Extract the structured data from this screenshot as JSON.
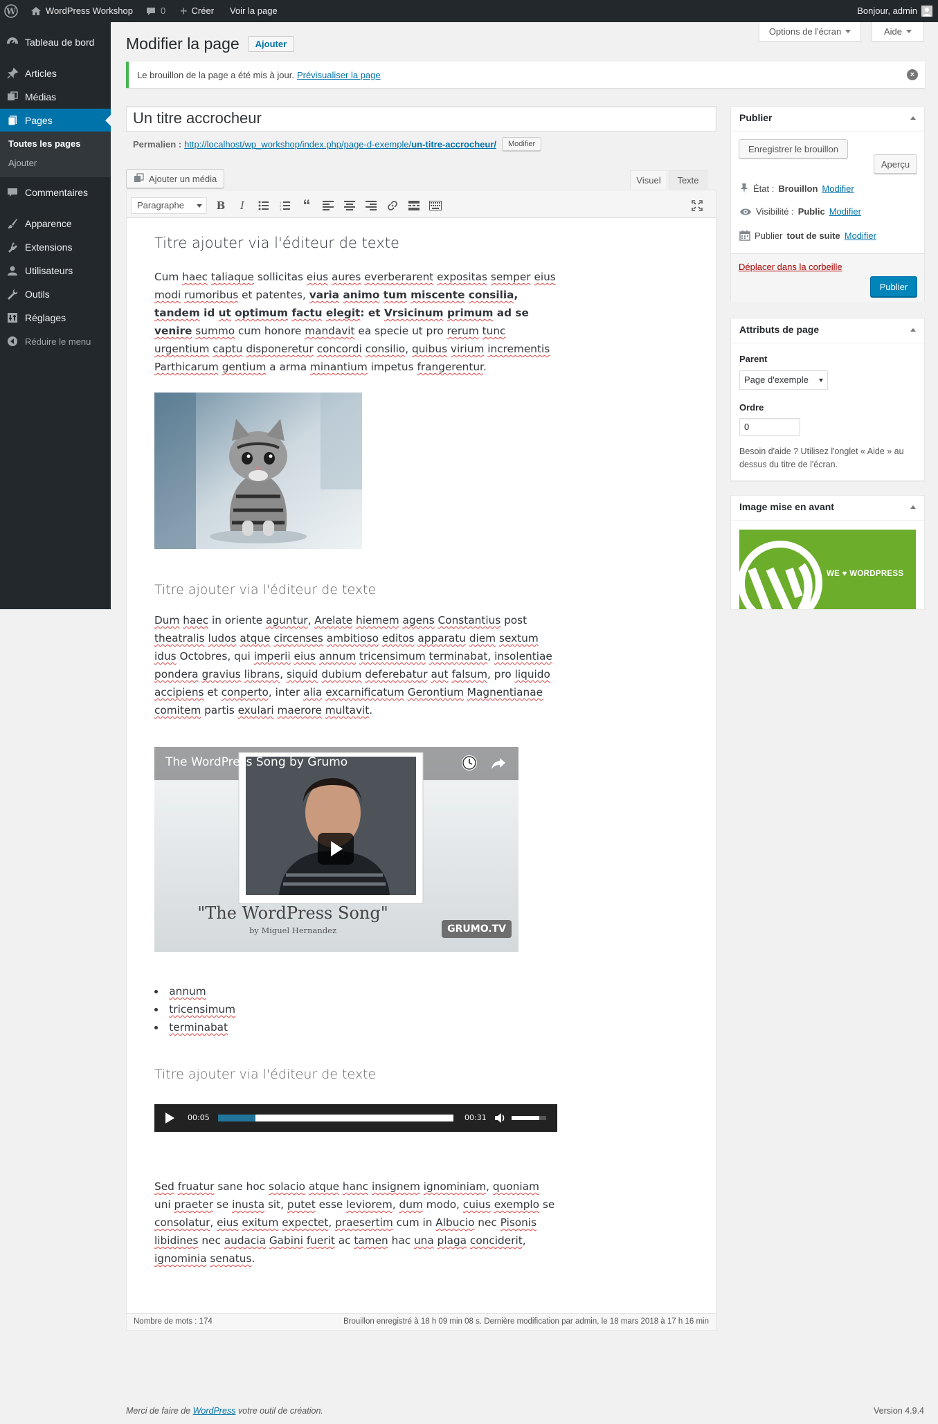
{
  "admin_bar": {
    "site_name": "WordPress Workshop",
    "comments_count": "0",
    "new_label": "Créer",
    "view_page_label": "Voir la page",
    "greeting": "Bonjour, admin"
  },
  "sidebar": {
    "items": [
      {
        "label": "Tableau de bord",
        "icon": "dashboard-icon"
      },
      {
        "label": "Articles",
        "icon": "pin-icon"
      },
      {
        "label": "Médias",
        "icon": "media-icon"
      },
      {
        "label": "Pages",
        "icon": "pages-icon"
      },
      {
        "label": "Commentaires",
        "icon": "comment-icon"
      },
      {
        "label": "Apparence",
        "icon": "brush-icon"
      },
      {
        "label": "Extensions",
        "icon": "plugin-icon"
      },
      {
        "label": "Utilisateurs",
        "icon": "user-icon"
      },
      {
        "label": "Outils",
        "icon": "wrench-icon"
      },
      {
        "label": "Réglages",
        "icon": "settings-icon"
      }
    ],
    "submenu": [
      "Toutes les pages",
      "Ajouter"
    ],
    "collapse_label": "Réduire le menu"
  },
  "screen_options": {
    "options_label": "Options de l'écran",
    "help_label": "Aide"
  },
  "header": {
    "title": "Modifier la page",
    "add_new_label": "Ajouter"
  },
  "notice": {
    "text": "Le brouillon de la page a été mis à jour.",
    "link": "Prévisualiser la page"
  },
  "post": {
    "title": "Un titre accrocheur",
    "permalink_label": "Permalien :",
    "permalink_base": "http://localhost/wp_workshop/index.php/page-d-exemple/",
    "permalink_slug": "un-titre-accrocheur/",
    "permalink_edit": "Modifier"
  },
  "editor": {
    "add_media_label": "Ajouter un média",
    "tab_visual": "Visuel",
    "tab_text": "Texte",
    "format_value": "Paragraphe",
    "heading_1": "Titre ajouter via l'éditeur de texte",
    "heading_2": "Titre ajouter via l'éditeur de texte",
    "heading_3": "Titre ajouter via l'éditeur de texte",
    "video_title": "The WordPress Song by Grumo",
    "video_caption": "\"The WordPress Song\"",
    "video_byline": "by Miguel Hernandez",
    "video_brand": "GRUMO.TV",
    "list_items": [
      "annum",
      "tricensimum",
      "terminabat"
    ],
    "audio_current": "00:05",
    "audio_duration": "00:31",
    "audio_progress": 0.16,
    "word_count": "Nombre de mots : 174",
    "autosave_status": "Brouillon enregistré à 18 h 09 min 08 s. Dernière modification par admin, le 18 mars 2018 à 17 h 16 min"
  },
  "publish_box": {
    "title": "Publier",
    "save_draft": "Enregistrer le brouillon",
    "preview": "Aperçu",
    "status_label": "État :",
    "status_value": "Brouillon",
    "visibility_label": "Visibilité :",
    "visibility_value": "Public",
    "schedule_label": "Publier",
    "schedule_value": "tout de suite",
    "edit_link": "Modifier",
    "trash": "Déplacer dans la corbeille",
    "publish": "Publier"
  },
  "page_attributes": {
    "title": "Attributs de page",
    "parent_label": "Parent",
    "parent_value": "Page d'exemple",
    "order_label": "Ordre",
    "order_value": "0",
    "help": "Besoin d'aide ? Utilisez l'onglet « Aide » au dessus du titre de l'écran."
  },
  "featured_image": {
    "title": "Image mise en avant",
    "banner_text": "WE ♥ WORDPRESS"
  },
  "footer": {
    "thanks_prefix": "Merci de faire de ",
    "thanks_link": "WordPress",
    "thanks_suffix": " votre outil de création.",
    "version": "Version 4.9.4"
  },
  "colors": {
    "admin_bar": "#23282d",
    "accent": "#0073aa",
    "notice_success": "#46b450",
    "trash": "#a00",
    "wp_green": "#6cad2c"
  }
}
